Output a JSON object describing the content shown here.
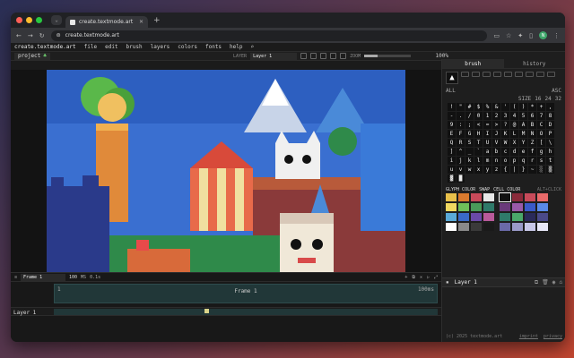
{
  "browser": {
    "tab_title": "create.textmode.art",
    "url": "create.textmode.art",
    "avatar_letter": "N"
  },
  "menu": {
    "brand": "create.textmode.art",
    "items": [
      "file",
      "edit",
      "brush",
      "layers",
      "colors",
      "fonts",
      "help"
    ]
  },
  "toolbar": {
    "project_label": "project",
    "layer_label": "LAYER",
    "layer_value": "Layer 1",
    "zoom_label": "ZOOM",
    "zoom_value": "100%",
    "zoom_fraction": 0.28
  },
  "timeline": {
    "frame_name": "Frame 1",
    "duration_value": "100",
    "duration_unit": "MS",
    "fps_hint": "0.1s",
    "frame_number": "1",
    "frame_label": "Frame 1",
    "frame_duration": "100ms",
    "layer_name": "Layer 1"
  },
  "panel": {
    "tab_brush": "brush",
    "tab_history": "history",
    "preview_glyph": "▲",
    "glyph_set_label": "ALL",
    "glyph_set_right": "ASC",
    "glyph_size_label": "SIZE",
    "glyph_sizes": [
      "16",
      "24",
      "32"
    ],
    "glyphs": [
      "!",
      "\"",
      "#",
      "$",
      "%",
      "&",
      "'",
      "(",
      ")",
      "*",
      "+",
      ",",
      "-",
      ".",
      "/",
      "0",
      "1",
      "2",
      "3",
      "4",
      "5",
      "6",
      "7",
      "8",
      "9",
      ":",
      ";",
      "<",
      "=",
      ">",
      "?",
      "@",
      "A",
      "B",
      "C",
      "D",
      "E",
      "F",
      "G",
      "H",
      "I",
      "J",
      "K",
      "L",
      "M",
      "N",
      "O",
      "P",
      "Q",
      "R",
      "S",
      "T",
      "U",
      "V",
      "W",
      "X",
      "Y",
      "Z",
      "[",
      "\\",
      "]",
      "^",
      "_",
      "`",
      "a",
      "b",
      "c",
      "d",
      "e",
      "f",
      "g",
      "h",
      "i",
      "j",
      "k",
      "l",
      "m",
      "n",
      "o",
      "p",
      "q",
      "r",
      "s",
      "t",
      "u",
      "v",
      "w",
      "x",
      "y",
      "z",
      "{",
      "|",
      "}",
      "~",
      "░",
      "▒",
      "▓",
      "█"
    ],
    "glyph_color_label": "GLYPH COLOR",
    "swap_label": "SWAP",
    "cell_color_label": "CELL COLOR",
    "cell_color_hint": "ALT+CLICK",
    "glyph_colors": [
      "#e8c04a",
      "#d97a2e",
      "#c84a5a",
      "#e8e8e8",
      "#f0d860",
      "#6fbf5a",
      "#4a9a5a",
      "#2f7a6a",
      "#5aaad8",
      "#3a6ac8",
      "#6a4aa8",
      "#b85a9a",
      "#ffffff",
      "#8a8a8a",
      "#3a3a3a",
      "#1a1a1a"
    ],
    "cell_colors": [
      "#111111",
      "#8a2a3a",
      "#c84a5a",
      "#e86a6a",
      "#6a3a7a",
      "#9a5aa8",
      "#3a5ac8",
      "#5a8ae8",
      "#2f7a6a",
      "#4aa86a",
      "#2a2a5a",
      "#4a4a8a",
      "#6a6aa8",
      "#9a9ac8",
      "#c8c8e8",
      "#e8e8f8"
    ],
    "layer_name": "Layer 1",
    "footer_copyright": "(c) 2025 textmode.art",
    "footer_links": [
      "imprint",
      "privacy"
    ]
  }
}
